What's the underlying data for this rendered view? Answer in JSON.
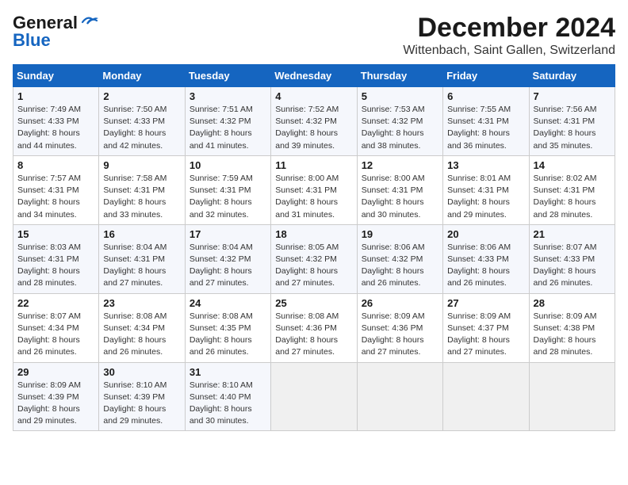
{
  "logo": {
    "line1": "General",
    "line2": "Blue"
  },
  "title": "December 2024",
  "location": "Wittenbach, Saint Gallen, Switzerland",
  "days_of_week": [
    "Sunday",
    "Monday",
    "Tuesday",
    "Wednesday",
    "Thursday",
    "Friday",
    "Saturday"
  ],
  "weeks": [
    [
      {
        "day": "1",
        "detail": "Sunrise: 7:49 AM\nSunset: 4:33 PM\nDaylight: 8 hours\nand 44 minutes."
      },
      {
        "day": "2",
        "detail": "Sunrise: 7:50 AM\nSunset: 4:33 PM\nDaylight: 8 hours\nand 42 minutes."
      },
      {
        "day": "3",
        "detail": "Sunrise: 7:51 AM\nSunset: 4:32 PM\nDaylight: 8 hours\nand 41 minutes."
      },
      {
        "day": "4",
        "detail": "Sunrise: 7:52 AM\nSunset: 4:32 PM\nDaylight: 8 hours\nand 39 minutes."
      },
      {
        "day": "5",
        "detail": "Sunrise: 7:53 AM\nSunset: 4:32 PM\nDaylight: 8 hours\nand 38 minutes."
      },
      {
        "day": "6",
        "detail": "Sunrise: 7:55 AM\nSunset: 4:31 PM\nDaylight: 8 hours\nand 36 minutes."
      },
      {
        "day": "7",
        "detail": "Sunrise: 7:56 AM\nSunset: 4:31 PM\nDaylight: 8 hours\nand 35 minutes."
      }
    ],
    [
      {
        "day": "8",
        "detail": "Sunrise: 7:57 AM\nSunset: 4:31 PM\nDaylight: 8 hours\nand 34 minutes."
      },
      {
        "day": "9",
        "detail": "Sunrise: 7:58 AM\nSunset: 4:31 PM\nDaylight: 8 hours\nand 33 minutes."
      },
      {
        "day": "10",
        "detail": "Sunrise: 7:59 AM\nSunset: 4:31 PM\nDaylight: 8 hours\nand 32 minutes."
      },
      {
        "day": "11",
        "detail": "Sunrise: 8:00 AM\nSunset: 4:31 PM\nDaylight: 8 hours\nand 31 minutes."
      },
      {
        "day": "12",
        "detail": "Sunrise: 8:00 AM\nSunset: 4:31 PM\nDaylight: 8 hours\nand 30 minutes."
      },
      {
        "day": "13",
        "detail": "Sunrise: 8:01 AM\nSunset: 4:31 PM\nDaylight: 8 hours\nand 29 minutes."
      },
      {
        "day": "14",
        "detail": "Sunrise: 8:02 AM\nSunset: 4:31 PM\nDaylight: 8 hours\nand 28 minutes."
      }
    ],
    [
      {
        "day": "15",
        "detail": "Sunrise: 8:03 AM\nSunset: 4:31 PM\nDaylight: 8 hours\nand 28 minutes."
      },
      {
        "day": "16",
        "detail": "Sunrise: 8:04 AM\nSunset: 4:31 PM\nDaylight: 8 hours\nand 27 minutes."
      },
      {
        "day": "17",
        "detail": "Sunrise: 8:04 AM\nSunset: 4:32 PM\nDaylight: 8 hours\nand 27 minutes."
      },
      {
        "day": "18",
        "detail": "Sunrise: 8:05 AM\nSunset: 4:32 PM\nDaylight: 8 hours\nand 27 minutes."
      },
      {
        "day": "19",
        "detail": "Sunrise: 8:06 AM\nSunset: 4:32 PM\nDaylight: 8 hours\nand 26 minutes."
      },
      {
        "day": "20",
        "detail": "Sunrise: 8:06 AM\nSunset: 4:33 PM\nDaylight: 8 hours\nand 26 minutes."
      },
      {
        "day": "21",
        "detail": "Sunrise: 8:07 AM\nSunset: 4:33 PM\nDaylight: 8 hours\nand 26 minutes."
      }
    ],
    [
      {
        "day": "22",
        "detail": "Sunrise: 8:07 AM\nSunset: 4:34 PM\nDaylight: 8 hours\nand 26 minutes."
      },
      {
        "day": "23",
        "detail": "Sunrise: 8:08 AM\nSunset: 4:34 PM\nDaylight: 8 hours\nand 26 minutes."
      },
      {
        "day": "24",
        "detail": "Sunrise: 8:08 AM\nSunset: 4:35 PM\nDaylight: 8 hours\nand 26 minutes."
      },
      {
        "day": "25",
        "detail": "Sunrise: 8:08 AM\nSunset: 4:36 PM\nDaylight: 8 hours\nand 27 minutes."
      },
      {
        "day": "26",
        "detail": "Sunrise: 8:09 AM\nSunset: 4:36 PM\nDaylight: 8 hours\nand 27 minutes."
      },
      {
        "day": "27",
        "detail": "Sunrise: 8:09 AM\nSunset: 4:37 PM\nDaylight: 8 hours\nand 27 minutes."
      },
      {
        "day": "28",
        "detail": "Sunrise: 8:09 AM\nSunset: 4:38 PM\nDaylight: 8 hours\nand 28 minutes."
      }
    ],
    [
      {
        "day": "29",
        "detail": "Sunrise: 8:09 AM\nSunset: 4:39 PM\nDaylight: 8 hours\nand 29 minutes."
      },
      {
        "day": "30",
        "detail": "Sunrise: 8:10 AM\nSunset: 4:39 PM\nDaylight: 8 hours\nand 29 minutes."
      },
      {
        "day": "31",
        "detail": "Sunrise: 8:10 AM\nSunset: 4:40 PM\nDaylight: 8 hours\nand 30 minutes."
      },
      {
        "day": "",
        "detail": ""
      },
      {
        "day": "",
        "detail": ""
      },
      {
        "day": "",
        "detail": ""
      },
      {
        "day": "",
        "detail": ""
      }
    ]
  ]
}
